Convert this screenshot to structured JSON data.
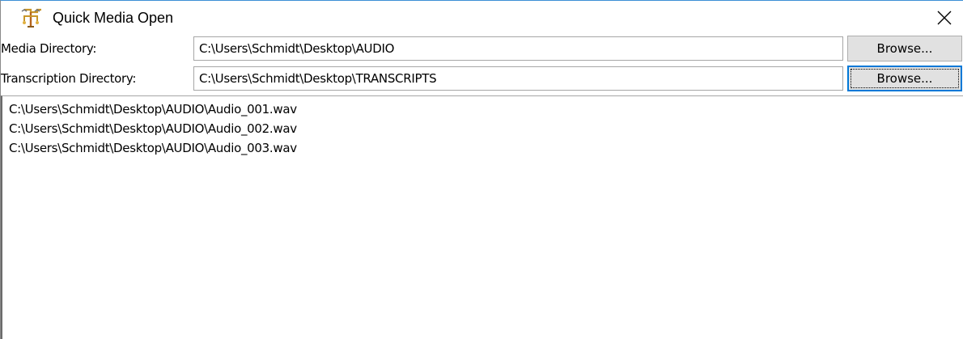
{
  "window": {
    "title": "Quick Media Open",
    "app_icon": "tree-media-icon",
    "close_icon": "close-icon"
  },
  "media_directory": {
    "label": "Media Directory:",
    "value": "C:\\Users\\Schmidt\\Desktop\\AUDIO",
    "browse_label": "Browse..."
  },
  "transcription_directory": {
    "label": "Transcription Directory:",
    "value": "C:\\Users\\Schmidt\\Desktop\\TRANSCRIPTS",
    "browse_label": "Browse..."
  },
  "files": [
    "C:\\Users\\Schmidt\\Desktop\\AUDIO\\Audio_001.wav",
    "C:\\Users\\Schmidt\\Desktop\\AUDIO\\Audio_002.wav",
    "C:\\Users\\Schmidt\\Desktop\\AUDIO\\Audio_003.wav"
  ],
  "colors": {
    "focus_blue": "#0078d7",
    "button_face": "#e1e1e1",
    "title_border": "#3c8fd6"
  }
}
